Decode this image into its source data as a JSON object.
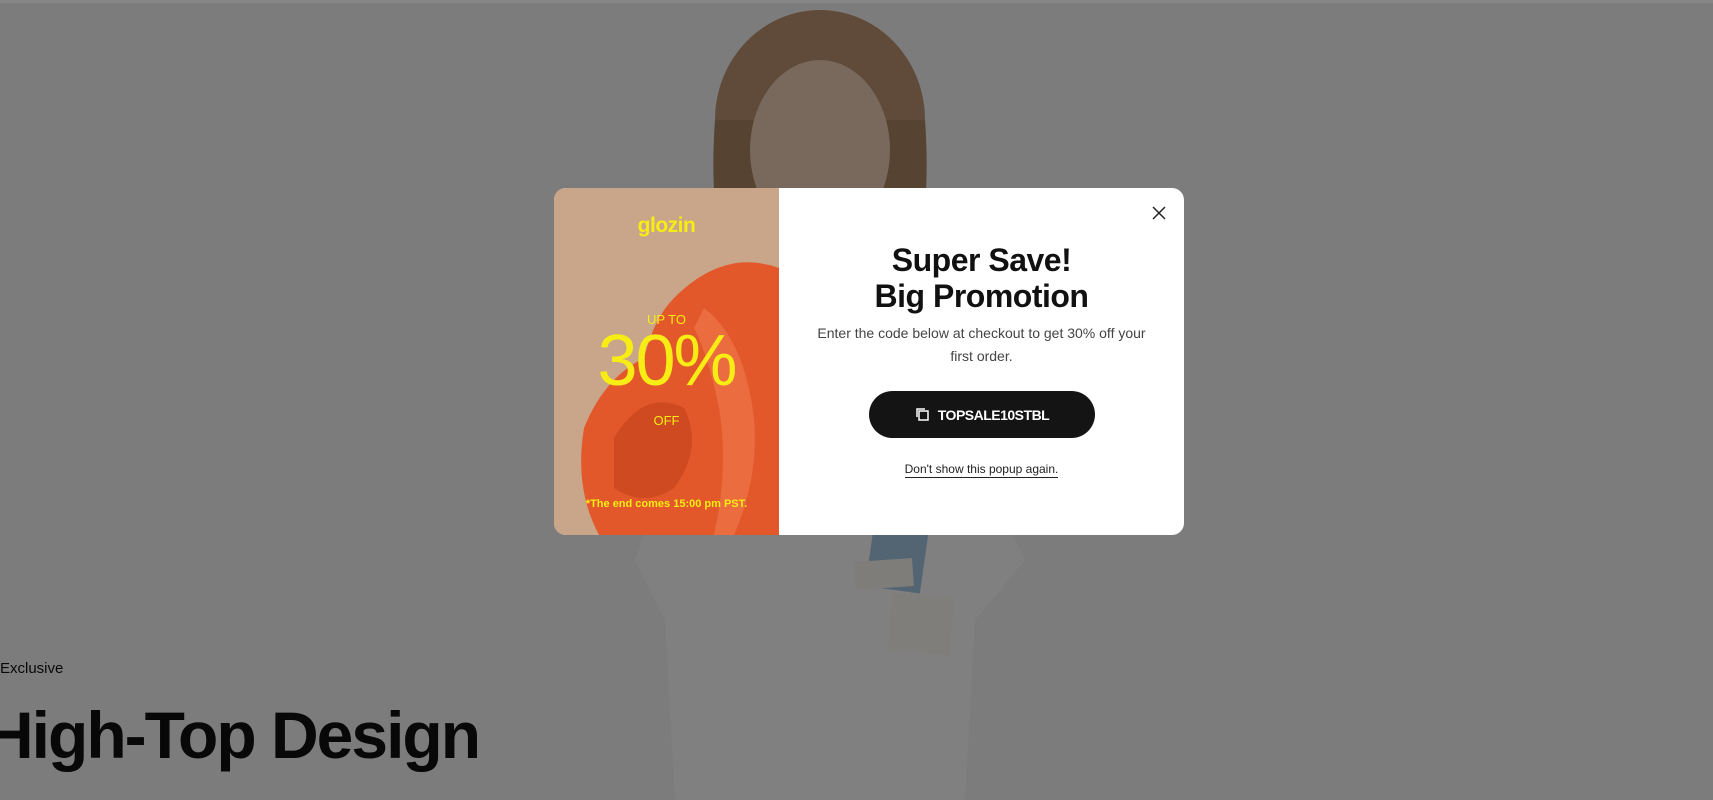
{
  "hero": {
    "eyebrow": "Exclusive",
    "title": "High-Top Design"
  },
  "popup": {
    "brand_logo": "glozin",
    "promo": {
      "up_to": "UP TO",
      "percent": "30%",
      "off": "OFF",
      "note": "*The end comes 15:00 pm PST."
    },
    "headline_line1": "Super Save!",
    "headline_line2": "Big Promotion",
    "subtext": "Enter the code below at checkout to get 30% off your first order.",
    "code": "TOPSALE10STBL",
    "dont_show": "Don't show this popup again.",
    "icons": {
      "close": "close-icon",
      "copy": "copy-icon"
    }
  },
  "colors": {
    "overlay": "#000000",
    "promo_yellow": "#f7ec13",
    "button_dark": "#141414",
    "panel_bg": "#c9a68a",
    "fabric_orange": "#e2582b"
  }
}
